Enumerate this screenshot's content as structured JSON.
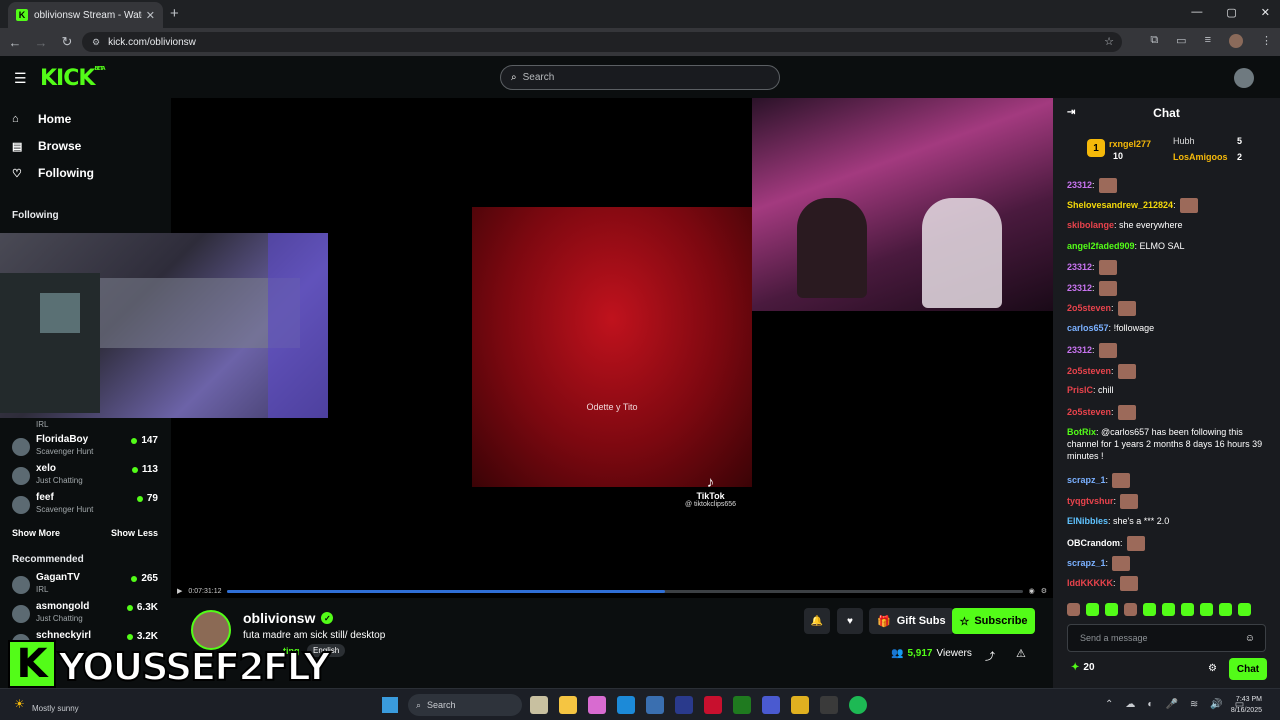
{
  "browser": {
    "tab_title": "oblivionsw Stream - Watch",
    "tab_close": "✕",
    "new_tab": "+",
    "url": "kick.com/oblivionsw",
    "controls": [
      "—",
      "▢",
      "✕"
    ]
  },
  "header": {
    "logo": "KICK",
    "logo_beta": "BETA",
    "search_placeholder": "Search"
  },
  "sidebar": {
    "nav": [
      {
        "label": "Home"
      },
      {
        "label": "Browse"
      },
      {
        "label": "Following"
      }
    ],
    "following_title": "Following",
    "following": [
      {
        "name": "FloridaBoy",
        "category": "Scavenger Hunt",
        "viewers": "147"
      },
      {
        "name": "xelo",
        "category": "Just Chatting",
        "viewers": "113"
      },
      {
        "name": "feef",
        "category": "Scavenger Hunt",
        "viewers": "79"
      }
    ],
    "irl_label": "IRL",
    "show_more": "Show More",
    "show_less": "Show Less",
    "recommended_title": "Recommended",
    "recommended": [
      {
        "name": "GaganTV",
        "category": "IRL",
        "viewers": "265"
      },
      {
        "name": "asmongold",
        "category": "Just Chatting",
        "viewers": "6.3K"
      },
      {
        "name": "schneckyirl",
        "category": "",
        "viewers": "3.2K"
      }
    ]
  },
  "player": {
    "clip_caption": "Odette y Tito",
    "tiktok_logo": "TikTok",
    "tiktok_handle": "@ tiktokclips656",
    "time": "0:07:31:12",
    "progress": 0.55
  },
  "stream": {
    "name": "oblivionsw",
    "title": "futa madre am sick still/ desktop",
    "category": "ting",
    "language": "English",
    "gift_subs": "Gift Subs",
    "subscribe": "Subscribe",
    "viewers_count": "5,917",
    "viewers_label": "Viewers"
  },
  "overlay": {
    "letter": "K",
    "name": "YOUSSEF2FLY"
  },
  "chat": {
    "title": "Chat",
    "leaderboard": {
      "rank": "1",
      "top_user": "rxngel277",
      "top_count": "10",
      "second_user": "Hubh",
      "second_count": "5",
      "third_user": "LosAmigoos",
      "third_count": "2"
    },
    "messages": [
      {
        "user": "23312",
        "color": "#c874f0",
        "text": ""
      },
      {
        "user": "Shelovesandrew_212824",
        "color": "#f5d90a",
        "text": ""
      },
      {
        "user": "skibolange",
        "color": "#e8434c",
        "text": " she everywhere"
      },
      {
        "user": "angel2faded909",
        "color": "#53fc18",
        "text": " ELMO SAL"
      },
      {
        "user": "23312",
        "color": "#c874f0",
        "text": ""
      },
      {
        "user": "23312",
        "color": "#c874f0",
        "text": ""
      },
      {
        "user": "2o5steven",
        "color": "#e8434c",
        "text": ""
      },
      {
        "user": "carlos657",
        "color": "#7ab0ff",
        "text": " !followage"
      },
      {
        "user": "23312",
        "color": "#c874f0",
        "text": ""
      },
      {
        "user": "2o5steven",
        "color": "#e8434c",
        "text": ""
      },
      {
        "user": "PrislC",
        "color": "#e8434c",
        "text": " chill"
      },
      {
        "user": "2o5steven",
        "color": "#e8434c",
        "text": ""
      },
      {
        "user": "BotRix",
        "color": "#53fc18",
        "text": " @carlos657 has been following this channel for 1 years 2 months 8 days 16 hours 39 minutes !"
      },
      {
        "user": "scrapz_1",
        "color": "#7ab0ff",
        "text": ""
      },
      {
        "user": "tyqgtvshur",
        "color": "#e8434c",
        "text": ""
      },
      {
        "user": "ElNibbles",
        "color": "#5fc3ff",
        "text": " she's a *** 2.0"
      },
      {
        "user": "OBCrandom",
        "color": "#ffffff",
        "text": ""
      },
      {
        "user": "scrapz_1",
        "color": "#7ab0ff",
        "text": ""
      },
      {
        "user": "IddKKKKK",
        "color": "#e8434c",
        "text": ""
      }
    ],
    "input_placeholder": "Send a message",
    "points": "20",
    "send_label": "Chat"
  },
  "taskbar": {
    "weather": "Mostly sunny",
    "search": "Search",
    "time": "7:43 PM",
    "date": "8/16/2025"
  },
  "colors": {
    "kick_green": "#53fc18",
    "background": "#0b0e0f",
    "chat_bg": "#191b1f"
  }
}
